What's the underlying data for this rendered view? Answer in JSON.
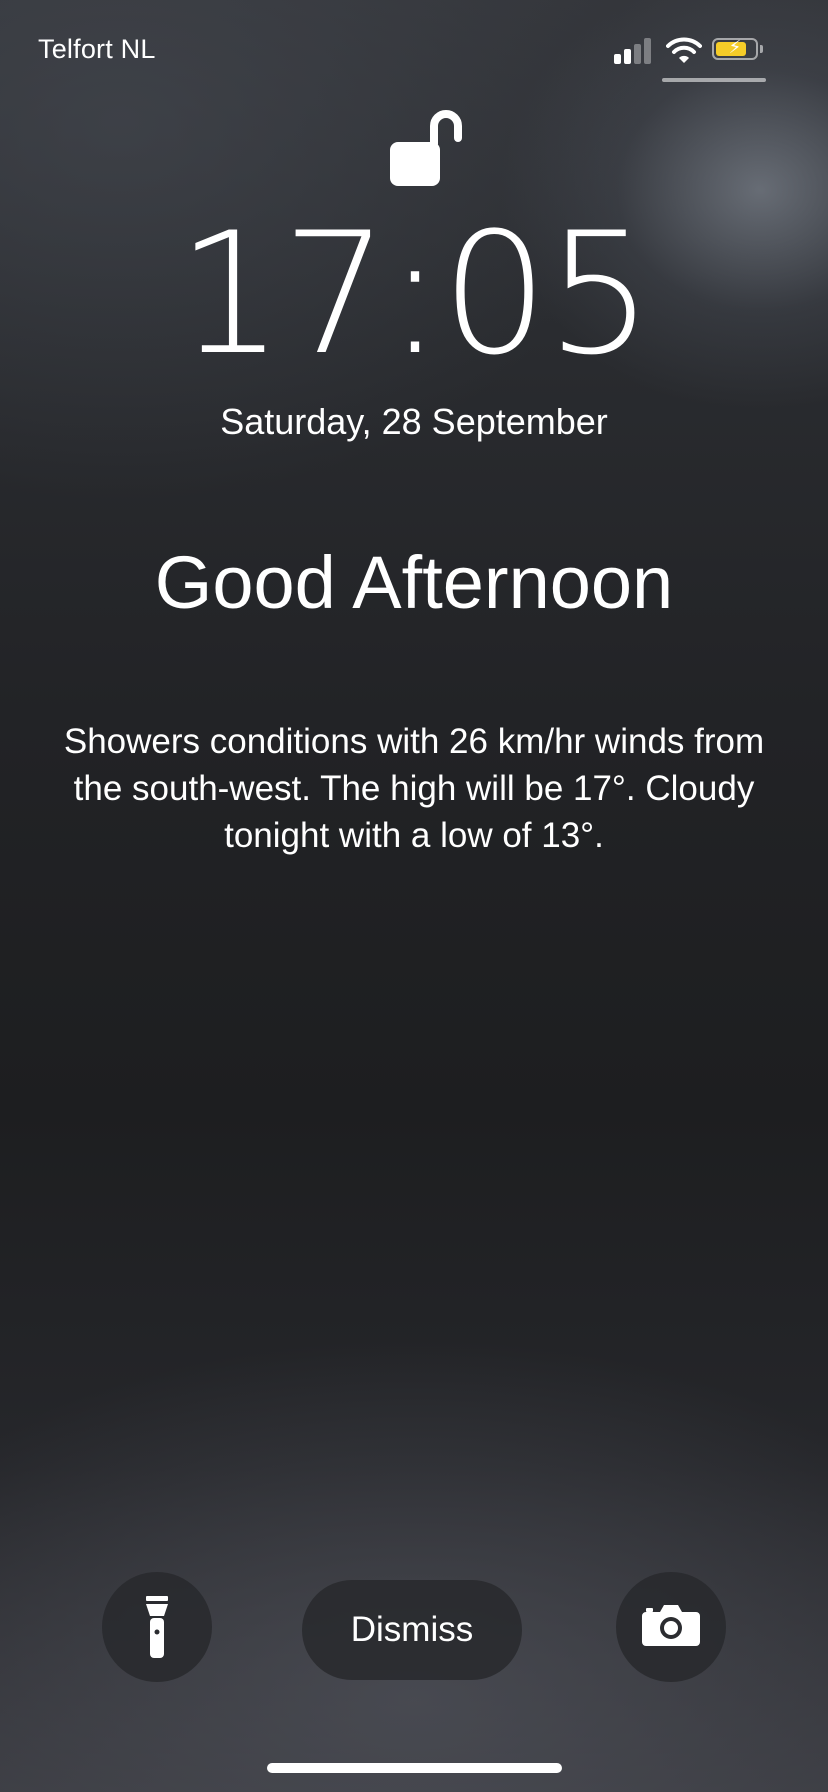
{
  "status_bar": {
    "carrier": "Telfort NL",
    "signal_bars": 2,
    "signal_bars_total": 4,
    "battery_level": 0.8,
    "battery_charging": true,
    "battery_color": "#f5cc28",
    "icons": [
      "signal-icon",
      "wifi-icon",
      "battery-icon"
    ]
  },
  "lock_screen": {
    "lock_state": "unlocked",
    "lock_icon": "unlocked-padlock-icon",
    "time": "17:05",
    "date": "Saturday, 28 September"
  },
  "notification": {
    "greeting": "Good Afternoon",
    "weather_text": "Showers conditions with 26 km/hr winds from the south-west. The high will be 17°. Cloudy tonight with a low of 13°."
  },
  "controls": {
    "flashlight_icon": "flashlight-icon",
    "dismiss_label": "Dismiss",
    "camera_icon": "camera-icon"
  }
}
